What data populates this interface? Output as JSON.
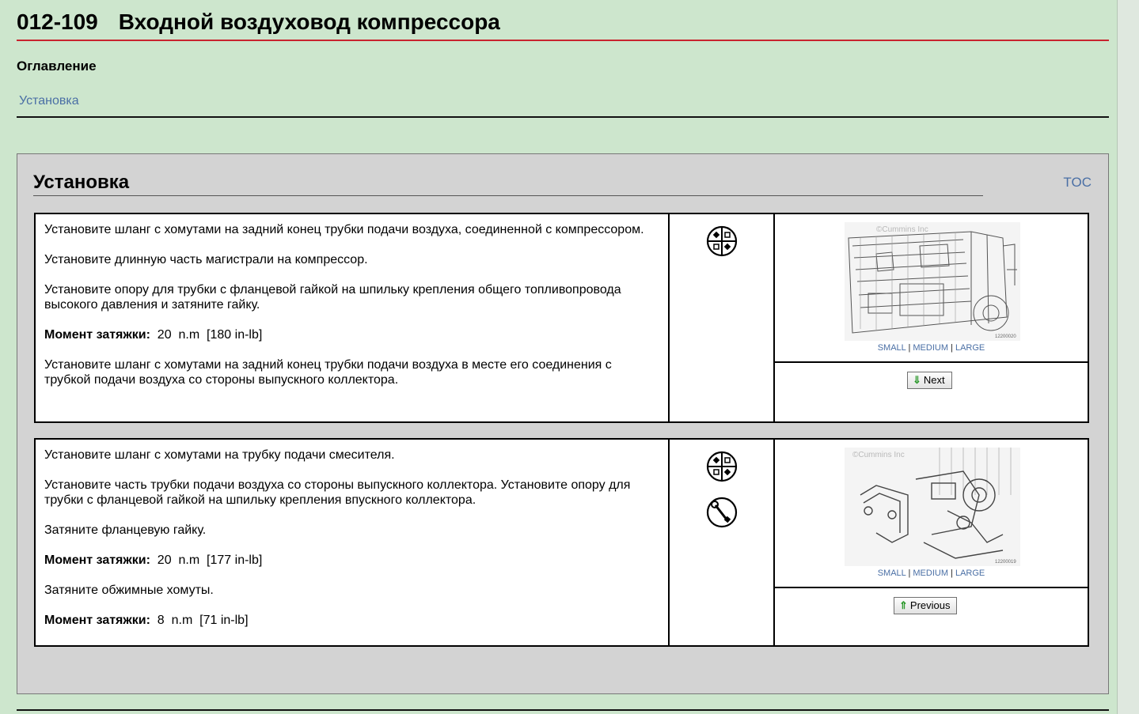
{
  "document": {
    "code": "012-109",
    "title": "Входной воздуховод компрессора"
  },
  "toc": {
    "heading": "Оглавление",
    "link_install": "Установка"
  },
  "section": {
    "title": "Установка",
    "toc_link": "TOC"
  },
  "steps": [
    {
      "paragraphs": [
        "Установите шланг с хомутами на задний конец трубки подачи воздуха, соединенной с компрессором.",
        "Установите длинную часть магистрали на компрессор.",
        "Установите опору для трубки с фланцевой гайкой на шпильку крепления общего топливопровода высокого давления и затяните гайку."
      ],
      "torque": {
        "label": "Момент затяжки:",
        "value": "20",
        "unit": "n.m",
        "alt": "[180 in-lb]"
      },
      "paragraph_after": "Установите шланг с хомутами на задний конец трубки подачи воздуха в месте его соединения с трубкой подачи воздуха со стороны выпускного коллектора.",
      "icons": [
        "tools-icon"
      ],
      "figure": {
        "watermark": "©Cummins Inc",
        "number": "12200020"
      },
      "nav_label": "Next"
    },
    {
      "paragraphs": [
        "Установите шланг с хомутами на трубку подачи смесителя.",
        "Установите часть трубки подачи воздуха со стороны выпускного коллектора. Установите опору для трубки с фланцевой гайкой на шпильку крепления впускного коллектора.",
        "Затяните фланцевую гайку."
      ],
      "torque": {
        "label": "Момент затяжки:",
        "value": "20",
        "unit": "n.m",
        "alt": "[177 in-lb]"
      },
      "paragraph_mid": "Затяните обжимные хомуты.",
      "torque2": {
        "label": "Момент затяжки:",
        "value": "8",
        "unit": "n.m",
        "alt": "[71 in-lb]"
      },
      "icons": [
        "tools-icon",
        "torque-wrench-icon"
      ],
      "figure": {
        "watermark": "©Cummins Inc",
        "number": "12200019"
      },
      "nav_label": "Previous"
    }
  ],
  "figure_links": {
    "small": "SMALL",
    "medium": "MEDIUM",
    "large": "LARGE",
    "sep": "|"
  }
}
